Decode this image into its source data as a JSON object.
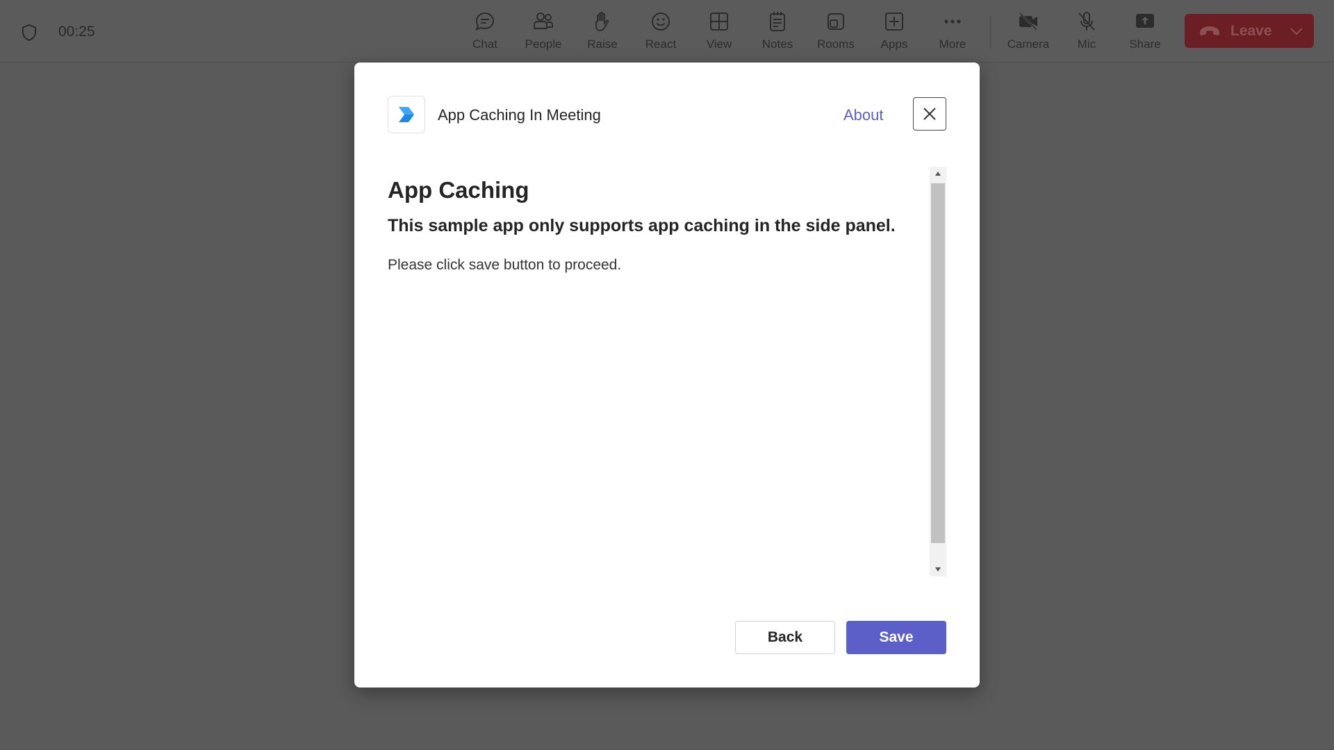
{
  "meeting": {
    "timer": "00:25",
    "toolbar": [
      {
        "label": "Chat",
        "icon": "chat-icon"
      },
      {
        "label": "People",
        "icon": "people-icon"
      },
      {
        "label": "Raise",
        "icon": "raise-hand-icon"
      },
      {
        "label": "React",
        "icon": "react-icon"
      },
      {
        "label": "View",
        "icon": "view-grid-icon"
      },
      {
        "label": "Notes",
        "icon": "notes-icon"
      },
      {
        "label": "Rooms",
        "icon": "rooms-icon"
      },
      {
        "label": "Apps",
        "icon": "apps-icon"
      },
      {
        "label": "More",
        "icon": "more-icon"
      },
      {
        "label": "Camera",
        "icon": "camera-off-icon"
      },
      {
        "label": "Mic",
        "icon": "mic-off-icon"
      },
      {
        "label": "Share",
        "icon": "share-icon"
      }
    ],
    "leave_label": "Leave"
  },
  "dialog": {
    "app_name": "App Caching In Meeting",
    "about_label": "About",
    "heading": "App Caching",
    "subheading": "This sample app only supports app caching in the side panel.",
    "body": "Please click save button to proceed.",
    "back_label": "Back",
    "save_label": "Save"
  },
  "colors": {
    "accent": "#5b5fc7",
    "leave": "#6b1f24",
    "overlay": "#5a5a5a"
  }
}
